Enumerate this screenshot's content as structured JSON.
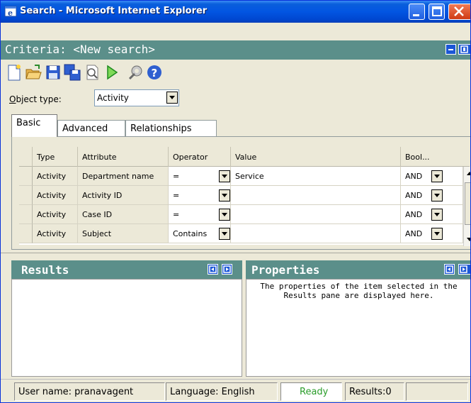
{
  "window": {
    "title": "Search - Microsoft Internet Explorer"
  },
  "criteria": {
    "title": "Criteria: <New search>"
  },
  "toolbar": {
    "icons": [
      "new-icon",
      "open-icon",
      "save-icon",
      "save-as-icon",
      "preview-icon",
      "run-icon",
      "tools-icon",
      "help-icon"
    ]
  },
  "object_type": {
    "label_accel": "O",
    "label_rest": "bject type:",
    "value": "Activity"
  },
  "tabs": [
    {
      "label": "Basic",
      "active": true
    },
    {
      "label": "Advanced",
      "active": false
    },
    {
      "label": "Relationships",
      "active": false
    }
  ],
  "grid": {
    "columns": [
      "Type",
      "Attribute",
      "Operator",
      "Value",
      "Bool..."
    ],
    "rows": [
      {
        "type": "Activity",
        "attribute": "Department name",
        "operator": "=",
        "value": "Service",
        "bool": "AND"
      },
      {
        "type": "Activity",
        "attribute": "Activity ID",
        "operator": "=",
        "value": "",
        "bool": "AND"
      },
      {
        "type": "Activity",
        "attribute": "Case ID",
        "operator": "=",
        "value": "",
        "bool": "AND"
      },
      {
        "type": "Activity",
        "attribute": "Subject",
        "operator": "Contains",
        "value": "",
        "bool": "AND"
      }
    ]
  },
  "results": {
    "title": "Results"
  },
  "properties": {
    "title": "Properties",
    "line1": "The properties of the item selected in the",
    "line2": "Results pane are displayed here."
  },
  "status": {
    "user": "User name: pranavagent",
    "language": "Language: English",
    "ready": "Ready",
    "results": "Results:0",
    "ready_color": "#2a9d2a"
  }
}
